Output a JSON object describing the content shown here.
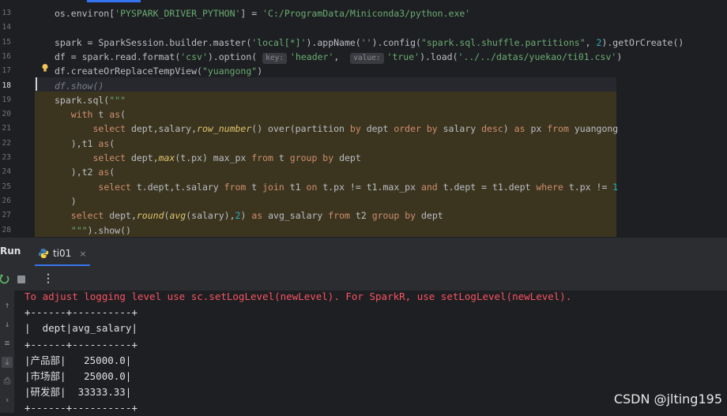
{
  "editor": {
    "lines": [
      {
        "n": "13",
        "html": "os.environ[<span class=\"str\">'PYSPARK_DRIVER_PYTHON'</span>] = <span class=\"str\">'C:/ProgramData/Miniconda3/python.exe'</span>"
      },
      {
        "n": "14",
        "html": ""
      },
      {
        "n": "15",
        "html": "spark = SparkSession.builder.master(<span class=\"str\">'local[*]'</span>).appName(<span class=\"str\">''</span>).config(<span class=\"str\">\"spark.sql.shuffle.partitions\"</span>, <span class=\"num\">2</span>).getOrCreate()"
      },
      {
        "n": "16",
        "html": "df = spark.read.format(<span class=\"str\">'csv'</span>).option( <span class=\"hint\">key:</span><span class=\"str\">'header'</span>,  <span class=\"hint\">value:</span><span class=\"str\">'true'</span>).load(<span class=\"str\">'../../datas/yuekao/ti01.csv'</span>)"
      },
      {
        "n": "17",
        "html": "df.createOrReplaceTempView(<span class=\"str\">\"yuangong\"</span>)"
      },
      {
        "n": "18",
        "html": "<span class=\"cm\">df.show()</span>"
      },
      {
        "n": "19",
        "html": "spark.sql(<span class=\"str\">\"\"\"</span>"
      },
      {
        "n": "20",
        "html": "   <span class=\"kw\">with</span> t <span class=\"kw\">as</span>("
      },
      {
        "n": "21",
        "html": "       <span class=\"kw\">select</span> dept,salary,<span class=\"it\">row_number</span>() over(partition <span class=\"kw\">by</span> dept <span class=\"kw\">order by</span> salary <span class=\"kw\">desc</span>) <span class=\"kw\">as</span> px <span class=\"kw\">from</span> yuangong"
      },
      {
        "n": "22",
        "html": "   ),t1 <span class=\"kw\">as</span>("
      },
      {
        "n": "23",
        "html": "       <span class=\"kw\">select</span> dept,<span class=\"it\">max</span>(t.px) max_px <span class=\"kw\">from</span> t <span class=\"kw\">group by</span> dept"
      },
      {
        "n": "24",
        "html": "   ),t2 <span class=\"kw\">as</span>("
      },
      {
        "n": "25",
        "html": "        <span class=\"kw\">select</span> t.dept,t.salary <span class=\"kw\">from</span> t <span class=\"kw\">join</span> t1 <span class=\"kw\">on</span> t.px != t1.max_px <span class=\"kw\">and</span> t.dept = t1.dept <span class=\"kw\">where</span> t.px != <span class=\"num\">1</span>"
      },
      {
        "n": "26",
        "html": "   )"
      },
      {
        "n": "27",
        "html": "   <span class=\"kw\">select</span> dept,<span class=\"it\">round</span>(<span class=\"it\">avg</span>(salary),<span class=\"num\">2</span>) <span class=\"kw\">as</span> avg_salary <span class=\"kw\">from</span> t2 <span class=\"kw\">group by</span> dept"
      },
      {
        "n": "28",
        "html": "   <span class=\"str\">\"\"\"</span>).show()"
      }
    ]
  },
  "run_panel": {
    "title": "Run",
    "tab_label": "ti01",
    "tab_close": "×"
  },
  "console": {
    "lines": [
      {
        "text": "To adjust logging level use sc.setLogLevel(newLevel). For SparkR, use setLogLevel(newLevel).",
        "type": "err"
      },
      {
        "text": "+------+----------+",
        "type": "out"
      },
      {
        "text": "|  dept|avg_salary|",
        "type": "out"
      },
      {
        "text": "+------+----------+",
        "type": "out"
      },
      {
        "text": "|产品部|   25000.0|",
        "type": "out"
      },
      {
        "text": "|市场部|   25000.0|",
        "type": "out"
      },
      {
        "text": "|研发部|  33333.33|",
        "type": "out"
      },
      {
        "text": "+------+----------+",
        "type": "out"
      }
    ]
  },
  "watermark": "CSDN @jlting195"
}
